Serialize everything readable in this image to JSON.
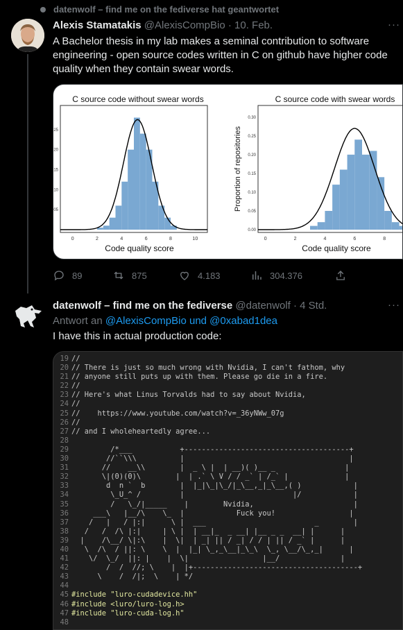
{
  "context": {
    "text": "datenwolf – find me on the fediverse hat geantwortet"
  },
  "tweet1": {
    "name": "Alexis Stamatakis",
    "handle_date": "@AlexisCompBio · 10. Feb.",
    "text": "A Bachelor thesis in my lab makes a seminal contribution to software engineering - open source codes written in C on github have higher code quality when they contain swear words.",
    "charts": [
      {
        "type": "bar",
        "title": "C source code without swear words",
        "xlabel": "Code quality score",
        "ylabel": "",
        "x_ticks": [
          "0",
          "2",
          "4",
          "6",
          "8",
          "10"
        ],
        "y_ticks": [
          "25",
          "20",
          "15",
          "10",
          "05"
        ],
        "bins_x": [
          2,
          2.5,
          3,
          3.5,
          4,
          4.5,
          5,
          5.5,
          6,
          6.5,
          7,
          7.5,
          8
        ],
        "values": [
          0.005,
          0.01,
          0.03,
          0.06,
          0.12,
          0.2,
          0.28,
          0.24,
          0.2,
          0.12,
          0.06,
          0.03,
          0.01
        ]
      },
      {
        "type": "bar",
        "title": "C source code with swear words",
        "xlabel": "Code quality score",
        "ylabel": "Proportion of repositories",
        "x_ticks": [
          "0",
          "2",
          "4",
          "6",
          "8"
        ],
        "y_ticks": [
          "0.30",
          "0.25",
          "0.20",
          "0.15",
          "0.10",
          "0.05",
          "0.00"
        ],
        "bins_x": [
          3,
          3.5,
          4,
          4.5,
          5,
          5.5,
          6,
          6.5,
          7,
          7.5,
          8,
          8.5,
          9
        ],
        "values": [
          0.01,
          0.02,
          0.05,
          0.12,
          0.16,
          0.2,
          0.24,
          0.2,
          0.21,
          0.14,
          0.05,
          0.02,
          0.01
        ]
      }
    ],
    "actions": {
      "reply": "89",
      "retweet": "875",
      "like": "4.183",
      "views": "304.376"
    }
  },
  "tweet2": {
    "name": "datenwolf – find me on the fediverse",
    "handle_date": "@datenwolf · 4 Std.",
    "reply_prefix": "Antwort an",
    "reply_to": "@AlexisCompBio und @0xabad1dea",
    "text": "I have this in actual production code:",
    "code": [
      [
        "19",
        "//"
      ],
      [
        "20",
        "// There is just so much wrong with Nvidia, I can't fathom, why"
      ],
      [
        "21",
        "// anyone still puts up with them. Please go die in a fire."
      ],
      [
        "22",
        "//"
      ],
      [
        "23",
        "// Here's what Linus Torvalds had to say about Nvidia,"
      ],
      [
        "24",
        "//"
      ],
      [
        "25",
        "//    https://www.youtube.com/watch?v=_36yNWw_07g"
      ],
      [
        "26",
        "//"
      ],
      [
        "27",
        "// and I wholeheartedly agree..."
      ],
      [
        "28",
        ""
      ],
      [
        "29",
        "         /*___           +--------------------------------------+"
      ],
      [
        "30",
        "        //``\\\\\\          |                                      |"
      ],
      [
        "31",
        "       //    __\\\\        |  _ \\ |  | __)( )__ _                |"
      ],
      [
        "32",
        "       \\|(0)(0)\\        |  | .` \\ V / / _` | /_` |             |"
      ],
      [
        "33",
        "        d  n `  b        |  |_|\\_|\\_/|_\\__,_|_\\__,( )            |"
      ],
      [
        "34",
        "         \\_U_^ /         |                         |/            |"
      ],
      [
        "35",
        "         /   \\_/|_____    |        Nvidia,                       |"
      ],
      [
        "36",
        "     ___\\   |__/\\    \\_  |            Fuck you!                 |"
      ],
      [
        "37",
        "    /   |   / |:|      \\ |  ___                         _        |"
      ],
      [
        "38",
        "   /   /  /\\ |:|     | \\ |  | __|_  _ __| |__ _ _  __| |      |"
      ],
      [
        "39",
        "  |    /\\__/ \\|:\\    |  \\|  | _| || / _| / / | || / _` |      |"
      ],
      [
        "40",
        "   \\  /\\  / ||: \\    \\  |  |_| \\_,_\\__|_\\_\\  \\_, \\__/\\_,_|      |"
      ],
      [
        "41",
        "    \\/  \\_/  ||: |    |  \\|                 |__/              |"
      ],
      [
        "42",
        "        /  /  //; \\    |  |+--------------------------------------+"
      ],
      [
        "43",
        "      \\    /  /|;  \\    | */"
      ],
      [
        "44",
        ""
      ],
      [
        "45",
        "#include \"luro-cudadevice.hh\""
      ],
      [
        "46",
        "#include <luro/luro-log.h>"
      ],
      [
        "47",
        "#include \"luro-cuda-log.h\""
      ],
      [
        "48",
        ""
      ]
    ]
  }
}
